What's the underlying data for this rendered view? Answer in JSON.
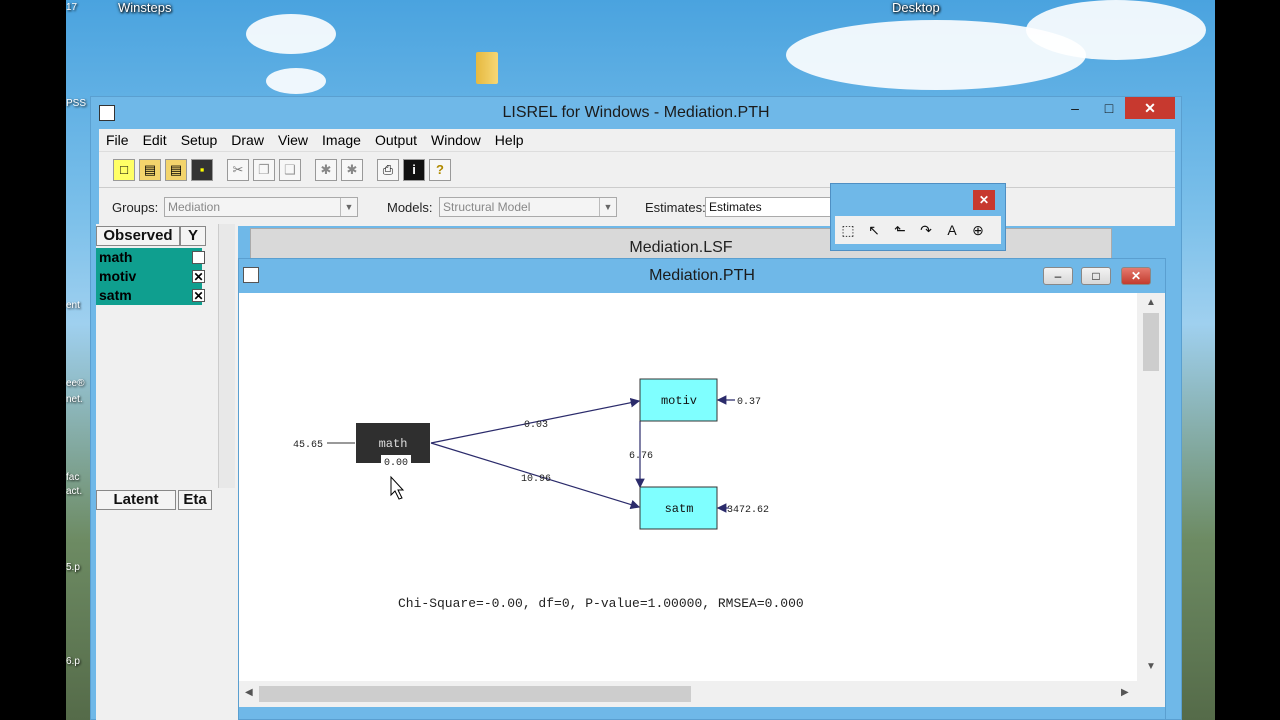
{
  "desktop": {
    "labels": [
      "Winsteps",
      "Desktop"
    ],
    "left_icon_texts": [
      "17",
      "PSS",
      "ent",
      "ee®",
      "net.",
      "fac",
      "act.",
      "5.p",
      "6.p"
    ]
  },
  "window": {
    "title": "LISREL for Windows - Mediation.PTH",
    "buttons": {
      "minimize": "–",
      "maximize": "□",
      "close": "✕"
    }
  },
  "menu": [
    "File",
    "Edit",
    "Setup",
    "Draw",
    "View",
    "Image",
    "Output",
    "Window",
    "Help"
  ],
  "toolbar_icons": [
    "new-icon",
    "open-icon",
    "open-folder-icon",
    "save-icon",
    "cut-icon",
    "copy-icon",
    "paste-icon",
    "run-icon",
    "run2-icon",
    "print-icon",
    "info-icon",
    "help-icon"
  ],
  "toolbar_glyphs": [
    "□",
    "▤",
    "▤",
    "▪",
    "✂",
    "❐",
    "❑",
    "✱",
    "✱",
    "⎙",
    "i",
    "?"
  ],
  "options": {
    "groups_label": "Groups:",
    "groups_value": "Mediation",
    "models_label": "Models:",
    "models_value": "Structural Model",
    "estimates_label": "Estimates:",
    "estimates_value": "Estimates"
  },
  "variables": {
    "observed_header": "Observed",
    "y_header": "Y",
    "latent_header": "Latent",
    "eta_header": "Eta",
    "observed": [
      {
        "name": "math",
        "y": ""
      },
      {
        "name": "motiv",
        "y": "✕"
      },
      {
        "name": "satm",
        "y": "✕"
      }
    ]
  },
  "windows": {
    "lsf_title": "Mediation.LSF",
    "pth_title": "Mediation.PTH"
  },
  "palette": {
    "close": "✕",
    "tools": [
      "⬚",
      "↖",
      "⬑",
      "↷",
      "A",
      "⊕"
    ]
  },
  "path_diagram": {
    "nodes": {
      "math": "math",
      "motiv": "motiv",
      "satm": "satm"
    },
    "labels": {
      "math_variance": "45.65",
      "math_to_motiv": "0.03",
      "math_to_satm": "10.96",
      "motiv_to_satm": "6.76",
      "motiv_error": "0.37",
      "satm_error": "3472.62",
      "math_small": "0.00"
    },
    "fit": "Chi-Square=-0.00, df=0, P-value=1.00000, RMSEA=0.000"
  }
}
